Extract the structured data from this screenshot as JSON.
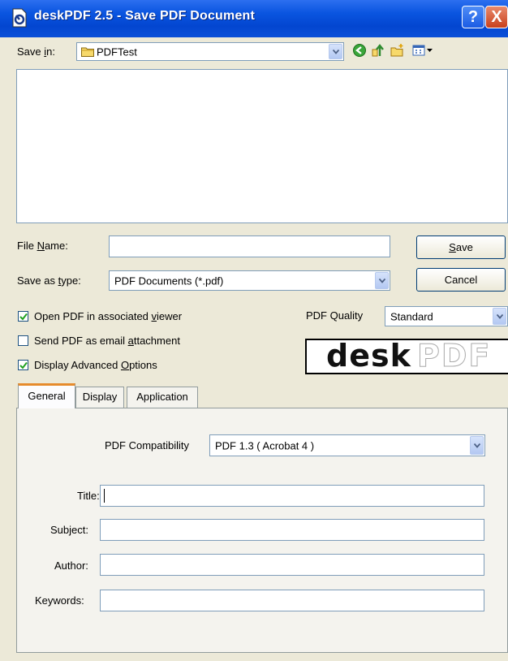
{
  "window": {
    "title": "deskPDF 2.5 - Save PDF Document",
    "help_label": "?",
    "close_label": "X"
  },
  "save_in": {
    "label_pre": "Save ",
    "label_key": "i",
    "label_post": "n:",
    "value": "PDFTest"
  },
  "toolbar": {
    "icons": [
      "back-icon",
      "up-folder-icon",
      "new-folder-icon",
      "view-menu-icon"
    ]
  },
  "file_name": {
    "label_key": "N",
    "label_pre": "File ",
    "label_post": "ame:",
    "value": ""
  },
  "save_as_type": {
    "label_pre": "Save as ",
    "label_key": "t",
    "label_post": "ype:",
    "value": "PDF Documents (*.pdf)"
  },
  "buttons": {
    "save_key": "S",
    "save_rest": "ave",
    "cancel": "Cancel"
  },
  "options": {
    "open_pdf": {
      "pre": "Open PDF in associated ",
      "key": "v",
      "post": "iewer",
      "checked": true
    },
    "send_email": {
      "pre": "Send PDF as email ",
      "key": "a",
      "post": "ttachment",
      "checked": false
    },
    "advanced": {
      "pre": "Display Advanced ",
      "key": "O",
      "post": "ptions",
      "checked": true
    }
  },
  "quality": {
    "label": "PDF Quality",
    "value": "Standard"
  },
  "logo": {
    "part1": "desk",
    "part2": "PDF"
  },
  "tabs": [
    "General",
    "Display",
    "Application"
  ],
  "general": {
    "compat_label": "PDF Compatibility",
    "compat_value": "PDF 1.3 ( Acrobat 4 )",
    "title_label": "Title:",
    "title_value": "",
    "subject_label": "Subject:",
    "subject_value": "",
    "author_label": "Author:",
    "author_value": "",
    "keywords_label": "Keywords:",
    "keywords_value": ""
  },
  "colors": {
    "titlebar": "#0a55e0",
    "dialog_bg": "#ece9d8",
    "tab_accent": "#e68b2c"
  }
}
